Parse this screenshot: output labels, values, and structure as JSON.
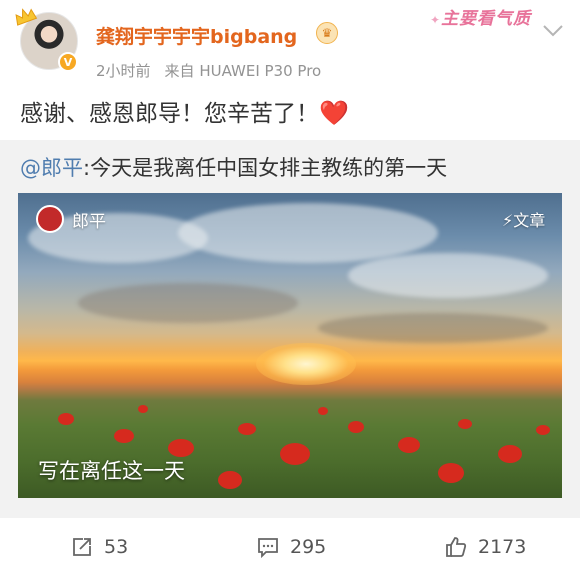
{
  "post": {
    "username": "龚翔宇宇宇宇bigbang",
    "time": "2小时前",
    "source": "来自 HUAWEI P30 Pro",
    "sticker": "主要看气质",
    "text": "感谢、感恩郎导！您辛苦了！",
    "heart": "❤️"
  },
  "repost": {
    "mention": "@郎平",
    "text": ":今天是我离任中国女排主教练的第一天",
    "article": {
      "author": "郎平",
      "tag": "文章",
      "title": "写在离任这一天"
    }
  },
  "actions": {
    "reposts": "53",
    "comments": "295",
    "likes": "2173"
  },
  "colors": {
    "username": "#e3661e",
    "mention": "#507daf",
    "repost_bg": "#f2f2f2"
  },
  "icons": [
    "crown-icon",
    "verified-icon",
    "vip-badge-icon",
    "chevron-down-icon",
    "share-icon",
    "comment-icon",
    "like-icon",
    "lightning-icon"
  ]
}
